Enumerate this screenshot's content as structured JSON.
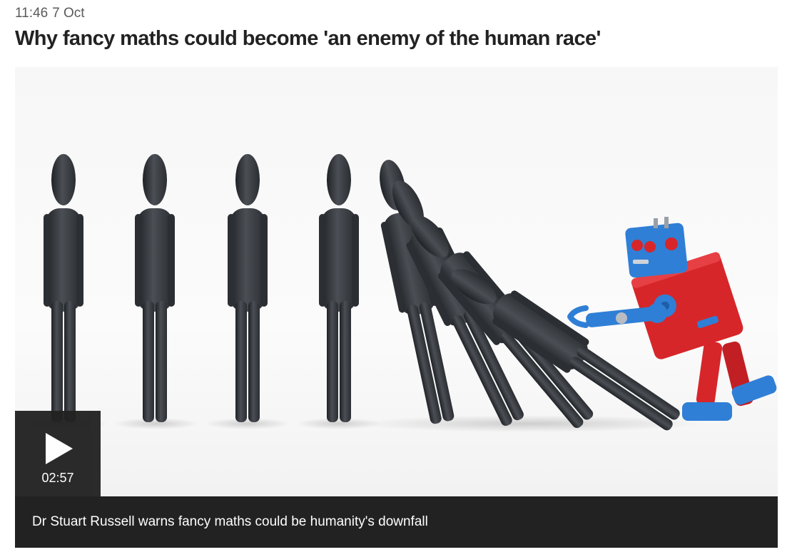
{
  "article": {
    "time": "11:46",
    "date": "7 Oct",
    "headline": "Why fancy maths could become 'an enemy of the human race'"
  },
  "video": {
    "duration": "02:57",
    "caption": "Dr Stuart Russell warns fancy maths could be humanity's downfall",
    "image_description_icon": "robot-toppling-figures-image",
    "colors": {
      "overlay": "#222222",
      "figure": "#3c3f44",
      "robot_blue": "#2f7fd6",
      "robot_red": "#d6262a"
    }
  }
}
